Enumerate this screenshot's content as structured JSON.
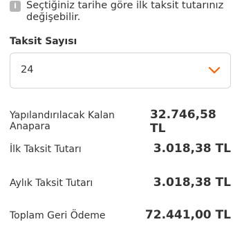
{
  "info": {
    "icon": "info-icon",
    "text": "Seçtiğiniz tarihe göre ilk taksit tutarınız değişebilir."
  },
  "installment_count": {
    "label": "Taksit Sayısı",
    "selected": "24",
    "icon": "chevron-down-icon",
    "accent": "#ff6200"
  },
  "summary": [
    {
      "label": "Yapılandırılacak Kalan Anapara",
      "value": "32.746,58 TL"
    },
    {
      "label": "İlk Taksit Tutarı",
      "value": "3.018,38 TL"
    },
    {
      "label": "Aylık Taksit Tutarı",
      "value": "3.018,38 TL"
    },
    {
      "label": "Toplam Geri Ödeme",
      "value": "72.441,00 TL"
    }
  ]
}
